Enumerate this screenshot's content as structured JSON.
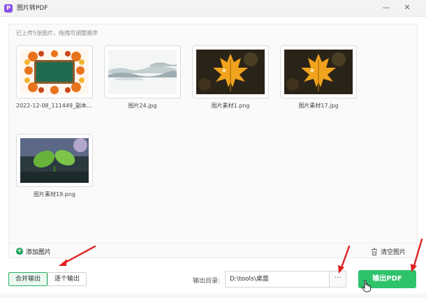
{
  "window": {
    "app_icon_letter": "P",
    "title": "图片转PDF",
    "minimize_symbol": "—",
    "close_symbol": "✕"
  },
  "panel": {
    "hint": "已上传5张图片，拖拽可调整顺序",
    "images": [
      {
        "name": "2022-12-08_111449_副本....",
        "kind": "autumn-board"
      },
      {
        "name": "图片24.jpg",
        "kind": "misty-mountains"
      },
      {
        "name": "图片素材1.png",
        "kind": "maple-leaf"
      },
      {
        "name": "图片素材17.jpg",
        "kind": "maple-leaf"
      },
      {
        "name": "图片素材19.png",
        "kind": "green-plant"
      }
    ]
  },
  "footer": {
    "add_label": "添加图片",
    "add_icon": "plus-circle-icon",
    "clear_label": "清空图片",
    "clear_icon": "trash-icon"
  },
  "bottom": {
    "merge_label": "合并输出",
    "separate_label": "逐个输出",
    "output_dir_label": "输出目录:",
    "output_dir_value": "D:\\tools\\桌面",
    "browse_label": "···",
    "export_label": "输出PDF"
  },
  "colors": {
    "accent": "#2ec36b",
    "annotation_arrow": "#e02020"
  }
}
